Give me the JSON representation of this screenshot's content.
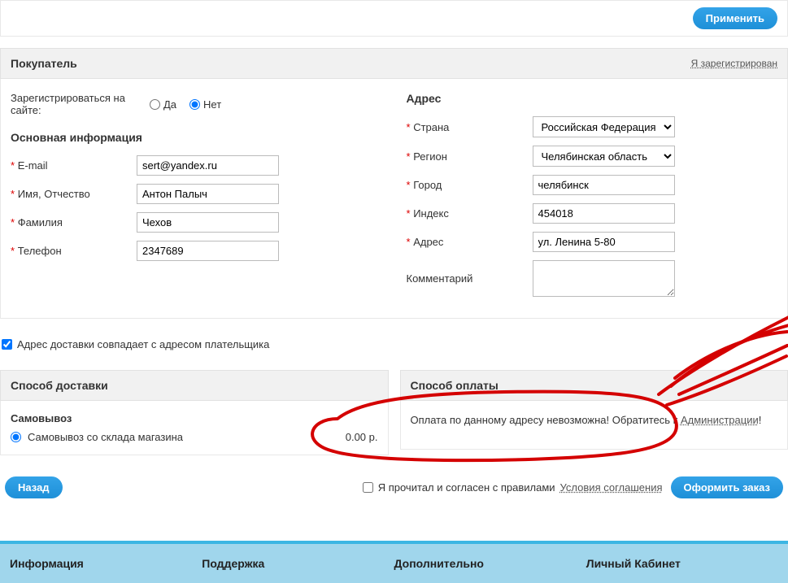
{
  "top": {
    "apply": "Применить"
  },
  "buyer": {
    "title": "Покупатель",
    "registered_link": "Я зарегистрирован",
    "register_on_site": "Зарегистрироваться на сайте:",
    "yes": "Да",
    "no": "Нет"
  },
  "main_info": {
    "title": "Основная информация",
    "email_label": "E-mail",
    "email_value": "sert@yandex.ru",
    "name_label": "Имя, Отчество",
    "name_value": "Антон Палыч",
    "surname_label": "Фамилия",
    "surname_value": "Чехов",
    "phone_label": "Телефон",
    "phone_value": "2347689"
  },
  "address": {
    "title": "Адрес",
    "country_label": "Страна",
    "country_value": "Российская Федерация",
    "region_label": "Регион",
    "region_value": "Челябинская область",
    "city_label": "Город",
    "city_value": "челябинск",
    "index_label": "Индекс",
    "index_value": "454018",
    "addr_label": "Адрес",
    "addr_value": "ул. Ленина 5-80",
    "comment_label": "Комментарий"
  },
  "same_address": "Адрес доставки совпадает с адресом плательщика",
  "delivery": {
    "header": "Способ доставки",
    "method_title": "Самовывоз",
    "option": "Самовывоз со склада магазина",
    "price": "0.00 р."
  },
  "payment": {
    "header": "Способ оплаты",
    "warning": "Оплата по данному адресу невозможна! Обратитесь к ",
    "admin_link": "Администрации",
    "excl": "!"
  },
  "bottom": {
    "back": "Назад",
    "agree": "Я прочитал и согласен с правилами ",
    "terms": "Условия соглашения",
    "submit": "Оформить заказ"
  },
  "footer": {
    "c1": "Информация",
    "c2": "Поддержка",
    "c3": "Дополнительно",
    "c4": "Личный Кабинет"
  }
}
